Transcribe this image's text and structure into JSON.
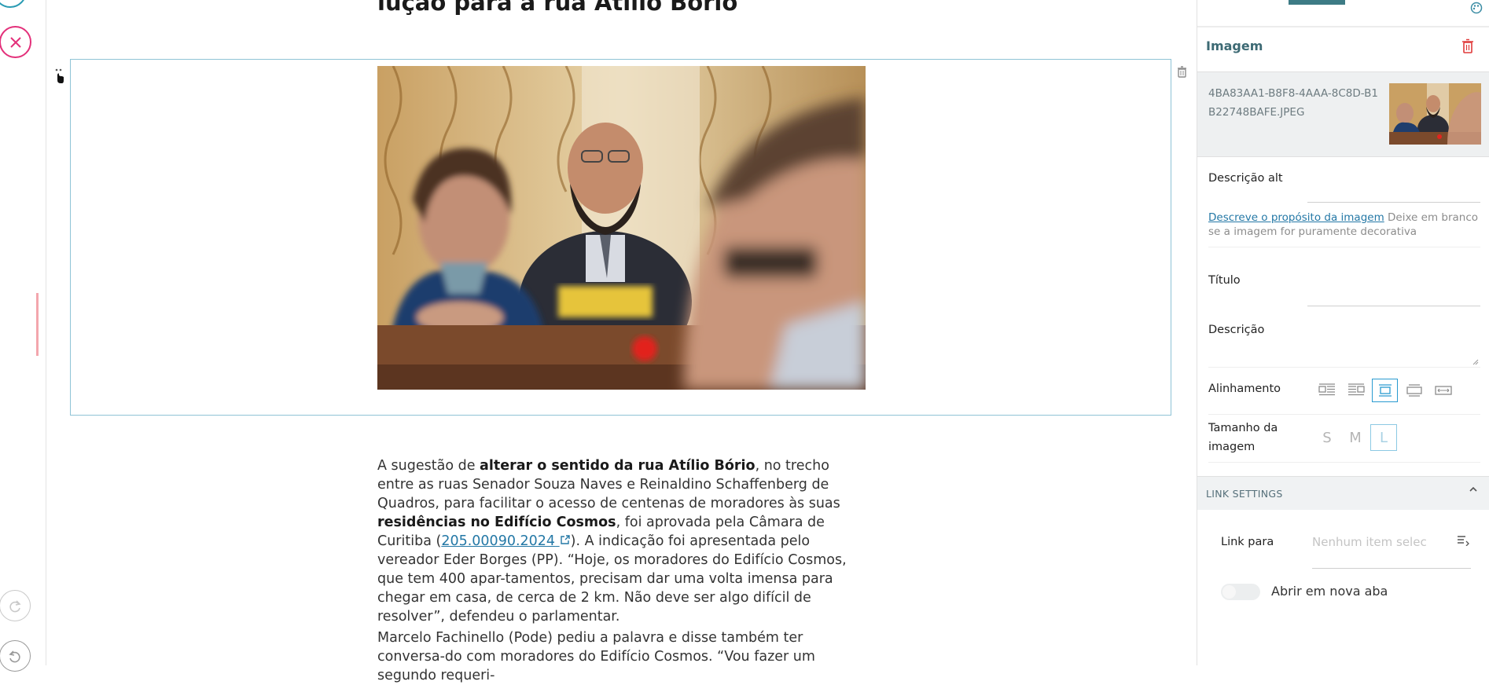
{
  "editor": {
    "heading": "lução para a rua Atílio Bório",
    "paragraph1": {
      "t1": "A sugestão de ",
      "b1": "alterar o sentido da rua Atílio Bório",
      "t2": ", no trecho entre as ruas Senador Souza Naves e Reinaldino Schaffenberg de Quadros, para facilitar o acesso de centenas de moradores às suas ",
      "b2": "residências no Edifício Cosmos",
      "t3": ", foi aprovada pela Câmara de Curitiba (",
      "link": "205.00090.2024",
      "t4": "). A indicação foi apresentada pelo vereador Eder Borges (PP). “Hoje, os moradores do Edifício Cosmos, que tem 400 apar-tamentos, precisam dar uma volta imensa para chegar em casa, de cerca de 2 km. Não deve ser algo difícil de resolver”, defendeu o parlamentar."
    },
    "paragraph2": "Marcelo Fachinello (Pode) pediu a palavra e disse também ter conversa-do com moradores do Edifício Cosmos. “Vou fazer um segundo requeri-"
  },
  "panel": {
    "title": "Imagem",
    "file_name": "4BA83AA1-B8F8-4AAA-8C8D-B1B22748BAFE.JPEG",
    "alt_label": "Descrição alt",
    "alt_help_link": "Descreve o propósito da imagem",
    "alt_help_text": " Deixe em branco se a imagem for puramente decorativa",
    "title_label": "Título",
    "description_label": "Descrição",
    "alignment_label": "Alinhamento",
    "size_label": "Tamanho da imagem",
    "sizes": [
      "S",
      "M",
      "L"
    ],
    "link_settings": "LINK SETTINGS",
    "link_to_label": "Link para",
    "link_to_placeholder": "Nenhum item selecionado",
    "new_tab_label": "Abrir em nova aba"
  },
  "colors": {
    "accent": "#2a9bb3",
    "close": "#e3307a",
    "delete": "#e03a3a",
    "link": "#2478a6"
  },
  "icons": [
    "close-icon",
    "redo-icon",
    "undo-icon",
    "drag-handle-icon",
    "trash-icon",
    "palette-icon",
    "chevron-up-icon",
    "list-select-icon"
  ]
}
